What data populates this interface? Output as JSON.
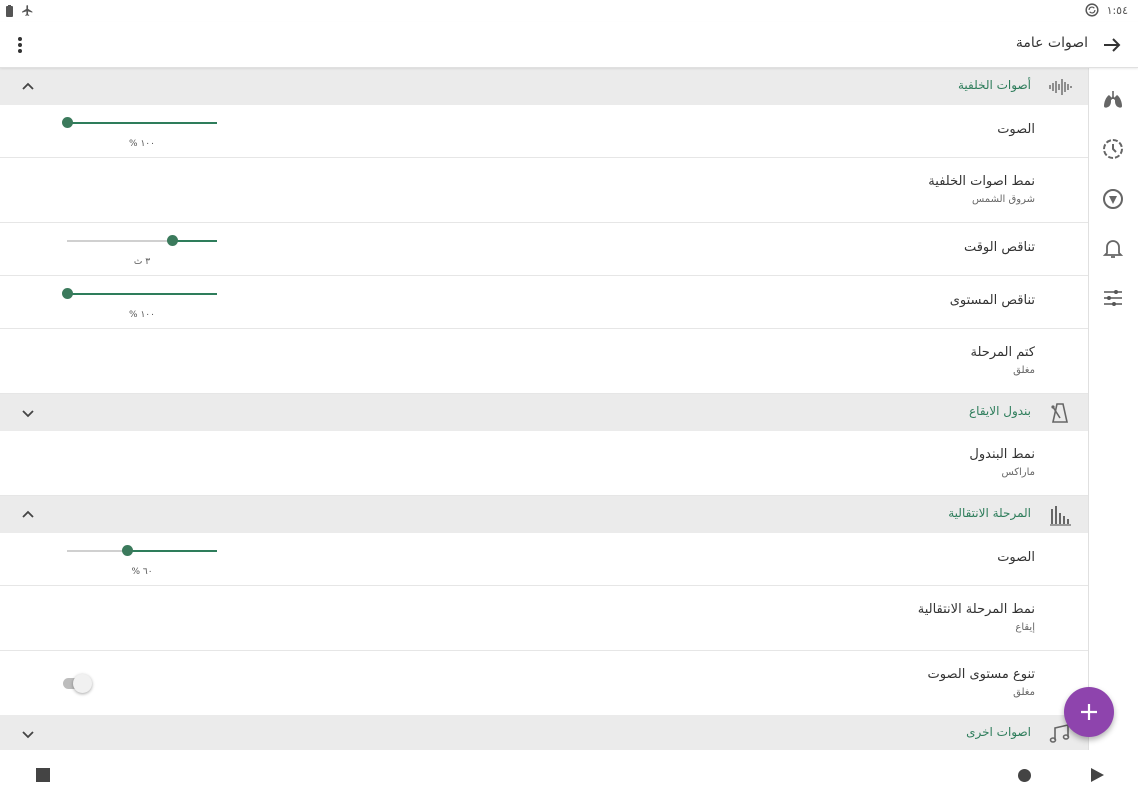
{
  "status_bar": {
    "time": "١:٥٤"
  },
  "app_bar": {
    "title": "اصوات عامة"
  },
  "sections": [
    {
      "title": "أصوات الخلفية",
      "icon": "waveform-icon",
      "expanded": true
    },
    {
      "title": "بندول الايقاع",
      "icon": "metronome-icon",
      "expanded": false
    },
    {
      "title": "المرحلة الانتقالية",
      "icon": "bars-icon",
      "expanded": true
    },
    {
      "title": "اصوات اخرى",
      "icon": "music-notes-icon",
      "expanded": false
    }
  ],
  "rows": {
    "bg_volume": {
      "label": "الصوت",
      "value_text": "١٠٠ %",
      "fraction": 1.0
    },
    "bg_pattern": {
      "label": "نمط اصوات الخلفية",
      "value": "شروق الشمس"
    },
    "time_fade": {
      "label": "تناقص الوقت",
      "value_text": "٣ ث",
      "fraction": 0.3
    },
    "level_fade": {
      "label": "تناقص المستوى",
      "value_text": "١٠٠ %",
      "fraction": 1.0
    },
    "stage_mute": {
      "label": "كتم المرحلة",
      "value": "مغلق"
    },
    "pendulum_pattern": {
      "label": "نمط البندول",
      "value": "ماراكس"
    },
    "trans_volume": {
      "label": "الصوت",
      "value_text": "٦٠ %",
      "fraction": 0.6
    },
    "trans_pattern": {
      "label": "نمط المرحلة الانتقالية",
      "value": "إيقاع"
    },
    "volume_variation": {
      "label": "تنوع مستوى الصوت",
      "value": "مغلق",
      "enabled": false
    }
  },
  "nav_rail": [
    "lungs-icon",
    "cycle-icon",
    "compass-icon",
    "bell-icon",
    "tune-icon"
  ],
  "colors": {
    "accent": "#2e7d5b",
    "fab": "#8e44ad",
    "section_bg": "#ebebeb"
  }
}
